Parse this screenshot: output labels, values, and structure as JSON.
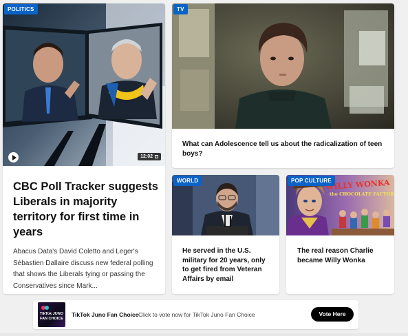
{
  "hero": {
    "category": "Politics",
    "duration": "12:02",
    "headline": "CBC Poll Tracker suggests Liberals in majority territory for first time in years",
    "description": "Abacus Data's David Coletto and Leger's Sébastien Dallaire discuss new federal polling that shows the Liberals tying or passing the Conservatives since Mark..."
  },
  "tv_card": {
    "category": "TV",
    "headline": "What can Adolescence tell us about the radicalization of teen boys?"
  },
  "world_card": {
    "category": "World",
    "headline": "He served in the U.S. military for 20 years, only to get fired from Veteran Affairs by email"
  },
  "pop_card": {
    "category": "Pop Culture",
    "headline": "The real reason Charlie became Willy Wonka",
    "poster_title_1": "WILLY WONKA",
    "poster_title_2": "the CHOCOLATE FACTORY"
  },
  "promo": {
    "logo_text": "TikTok JUNO FAN CHOICE",
    "title": "TikTok Juno Fan Choice",
    "text": "Click to vote now for TikTok Juno Fan Choice",
    "button_label": "Vote Here"
  },
  "colors": {
    "badge": "#0b63c7",
    "page_bg": "#f0f0f0"
  }
}
